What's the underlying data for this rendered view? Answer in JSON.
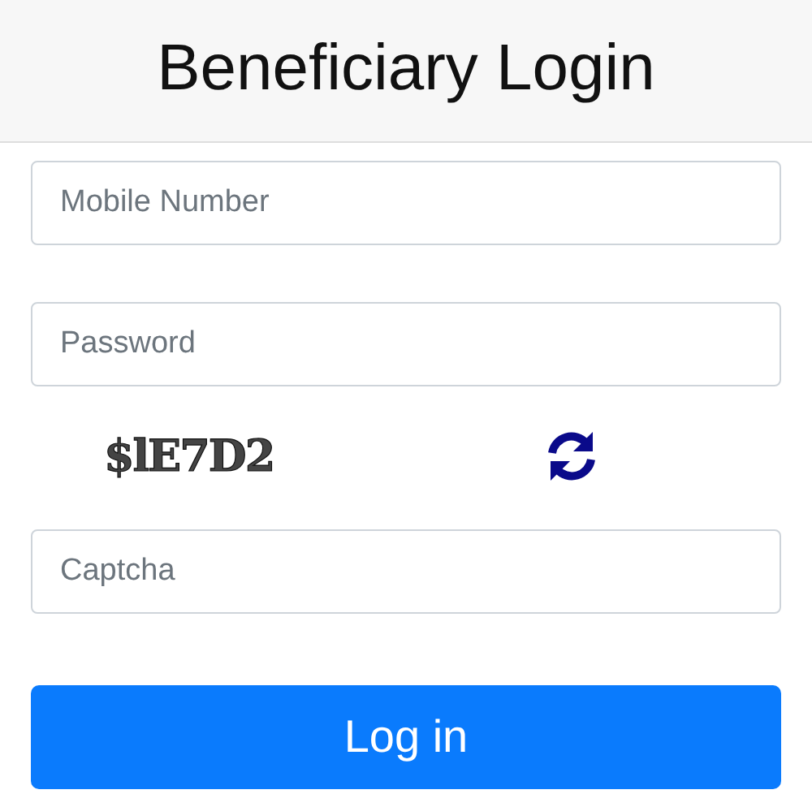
{
  "header": {
    "title": "Beneficiary Login"
  },
  "fields": [
    {
      "placeholder": "Mobile Number"
    },
    {
      "placeholder": "Password"
    }
  ],
  "captcha": {
    "code": "$lE7D2"
  },
  "captcha_field": {
    "placeholder": "Captcha"
  },
  "login_button": {
    "label": "Log in"
  }
}
